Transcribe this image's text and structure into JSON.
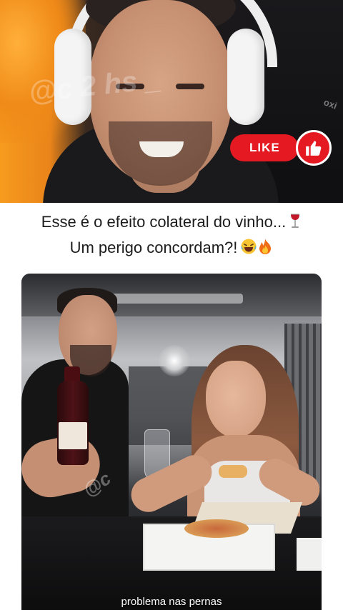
{
  "top_video": {
    "watermark": "@c        2   hs _",
    "chair_logo": "oxi",
    "like_button": {
      "label": "LIKE",
      "color": "#e51922"
    }
  },
  "caption": {
    "line1": "Esse é o efeito colateral do vinho...",
    "line2": "Um perigo concordam?!"
  },
  "bottom_video": {
    "watermark": "@c",
    "subtitle": "problema nas pernas"
  }
}
